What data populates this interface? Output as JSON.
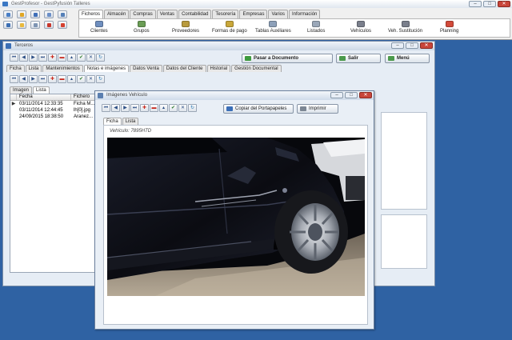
{
  "app": {
    "title": "GestProfesor - GestPyfusión Talleres",
    "menu_tabs": [
      "Ficheros",
      "Almacén",
      "Compras",
      "Ventas",
      "Contabilidad",
      "Tesorería",
      "Empresas",
      "Varios",
      "Información"
    ],
    "ribbon": [
      "Clientes",
      "Grupos",
      "Proveedores",
      "Formas de pago",
      "Tablas Auxiliares",
      "Listados",
      "Vehículos",
      "Veh. Sustitución",
      "Planning"
    ],
    "quick_icons": [
      "users-icon",
      "star-icon",
      "grid-icon",
      "book-icon",
      "search-icon",
      "print-icon",
      "folder-icon",
      "calculator-icon",
      "pdf-icon",
      "mail-icon"
    ]
  },
  "terceros": {
    "title": "Terceros",
    "buttons": {
      "pasar": "Pasar a Documento",
      "salir": "Salir",
      "menu": "Menú"
    },
    "tabs": [
      "Ficha",
      "Lista",
      "Mantenimientos",
      "Notas e imágenes",
      "Datos Venta",
      "Datos del Cliente",
      "Historial",
      "Gestión Documental"
    ],
    "inner_tabs": [
      "Imagen",
      "Lista"
    ],
    "columns": [
      "Fecha",
      "Fichero"
    ],
    "rows": [
      {
        "fecha": "03/11/2014 12:33:35",
        "fichero": "Ficha M..."
      },
      {
        "fecha": "03/11/2014 12:44:45",
        "fichero": "lh[0].jpg"
      },
      {
        "fecha": "24/09/2015 18:38:50",
        "fichero": "Aranez..."
      }
    ]
  },
  "image_window": {
    "title": "Imágenes Vehículo",
    "copy_button": "Copiar del Portapapeles",
    "print_button": "Imprimir",
    "tabs": [
      "Ficha",
      "Lista"
    ],
    "vehicle_label": "Vehículo: 7895HTD"
  }
}
